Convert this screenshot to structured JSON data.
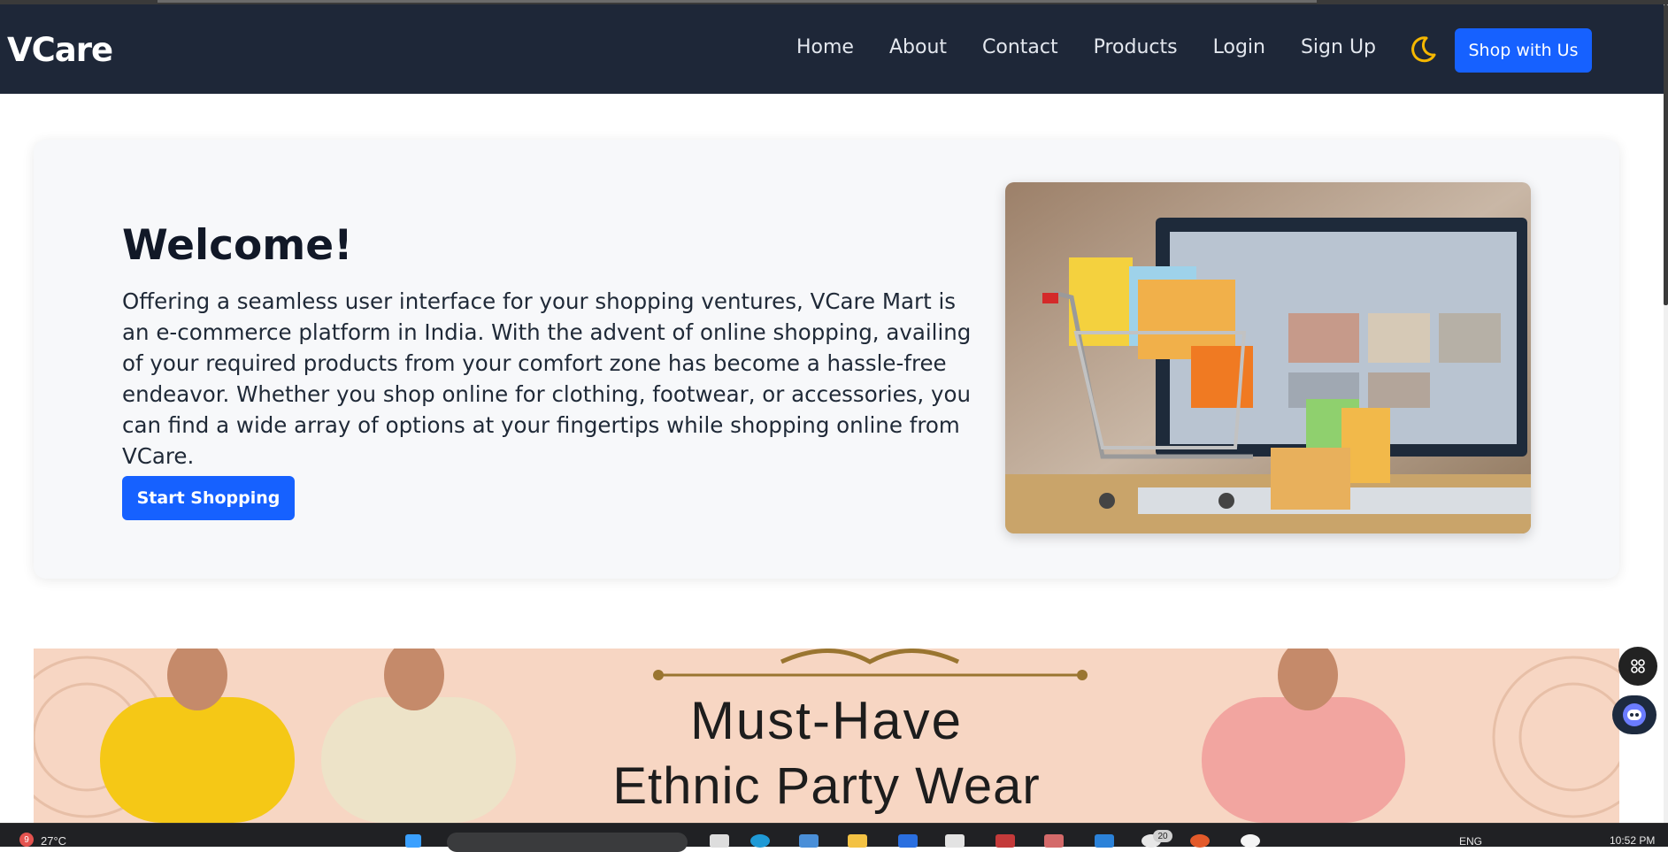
{
  "brand": "VCare",
  "nav": {
    "links": [
      "Home",
      "About",
      "Contact",
      "Products",
      "Login",
      "Sign Up"
    ],
    "theme_toggle_icon": "moon-icon",
    "cta_label": "Shop with Us"
  },
  "hero": {
    "title": "Welcome!",
    "text": "Offering a seamless user interface for your shopping ventures, VCare Mart is an e-commerce platform in India. With the advent of online shopping, availing of your required products from your comfort zone has become a hassle-free endeavor. Whether you shop online for clothing, footwear, or accessories, you can find a wide array of options at your fingertips while shopping online from VCare.",
    "button_label": "Start Shopping",
    "image_icon": "shopping-cart-with-bags-image"
  },
  "banner": {
    "line1": "Must-Have",
    "line2": "Ethnic Party Wear"
  },
  "floating": {
    "top_icon": "grid-apps-icon",
    "bottom_icon": "chat-bot-icon"
  },
  "taskbar": {
    "notification_count": "9",
    "weather": "27°C",
    "language": "ENG",
    "time": "10:52 PM",
    "badge_count": "20"
  },
  "colors": {
    "navbar_bg": "#1e2738",
    "accent_blue": "#1661ff",
    "moon_yellow": "#f5b700",
    "banner_bg": "#f7d6c3"
  }
}
